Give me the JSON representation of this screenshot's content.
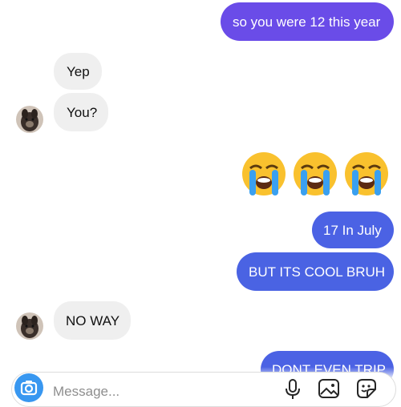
{
  "messages": [
    {
      "side": "outgoing",
      "text": "so you were 12 this year"
    },
    {
      "side": "incoming",
      "text": "Yep"
    },
    {
      "side": "incoming",
      "text": "You?"
    },
    {
      "side": "outgoing",
      "type": "emoji",
      "emoji": [
        "loudly-crying-face",
        "loudly-crying-face",
        "loudly-crying-face"
      ]
    },
    {
      "side": "outgoing",
      "text": "17 In July"
    },
    {
      "side": "outgoing",
      "text": "BUT ITS COOL BRUH"
    },
    {
      "side": "incoming",
      "text": "NO WAY"
    },
    {
      "side": "outgoing",
      "text": "DONT EVEN TRIP"
    }
  ],
  "composer": {
    "placeholder": "Message...",
    "icons": [
      "camera-icon",
      "microphone-icon",
      "gallery-icon",
      "sticker-icon"
    ]
  },
  "colors": {
    "outgoing_purple": "#6a4ce8",
    "outgoing_blue": "#4a63e3",
    "incoming_bg": "#efefef",
    "camera_blue": "#3897f0"
  }
}
